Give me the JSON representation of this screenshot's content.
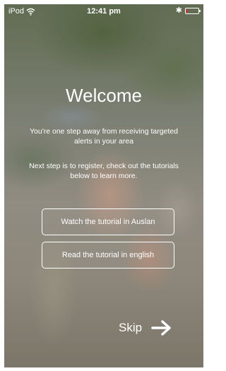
{
  "status_bar": {
    "carrier": "iPod",
    "time": "12:41 pm",
    "battery_level_percent": 15,
    "battery_color": "#e8262d",
    "icons": [
      "wifi-icon",
      "bluetooth-icon",
      "battery-icon"
    ]
  },
  "welcome": {
    "title": "Welcome",
    "subtitle": "You're one step away from receiving targeted alerts in your area",
    "instructions": "Next step is to register, check out the tutorials below to learn more."
  },
  "buttons": {
    "auslan_label": "Watch the tutorial in Auslan",
    "english_label": "Read the tutorial in english",
    "skip_label": "Skip",
    "skip_icon": "arrow-right-icon"
  }
}
